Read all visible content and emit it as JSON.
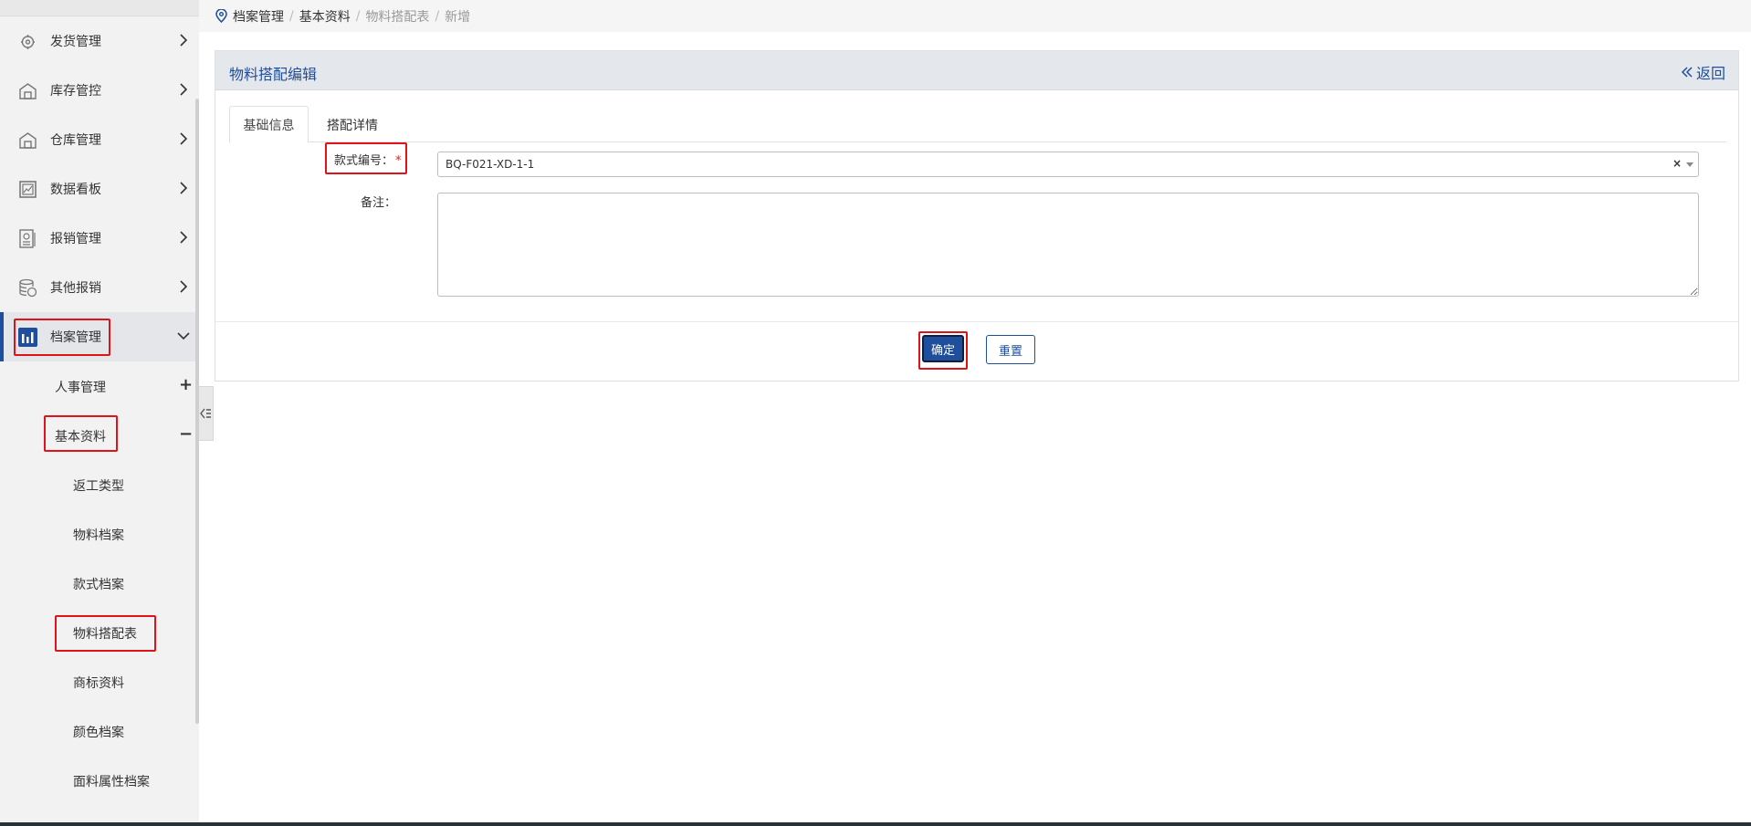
{
  "breadcrumb": {
    "items": [
      "档案管理",
      "基本资料",
      "物料搭配表",
      "新增"
    ]
  },
  "sidebar": {
    "items": [
      {
        "label": "发货管理",
        "icon": "truck-gear-icon"
      },
      {
        "label": "库存管控",
        "icon": "warehouse-icon"
      },
      {
        "label": "仓库管理",
        "icon": "warehouse-icon"
      },
      {
        "label": "数据看板",
        "icon": "chart-board-icon"
      },
      {
        "label": "报销管理",
        "icon": "receipt-icon"
      },
      {
        "label": "其他报销",
        "icon": "coins-icon"
      },
      {
        "label": "档案管理",
        "icon": "bar-chart-icon"
      }
    ],
    "subgroups": [
      {
        "label": "人事管理",
        "toggle": "+"
      },
      {
        "label": "基本资料",
        "toggle": "−"
      }
    ],
    "subitems": [
      "返工类型",
      "物料档案",
      "款式档案",
      "物料搭配表",
      "商标资料",
      "颜色档案",
      "面料属性档案"
    ]
  },
  "panel": {
    "title": "物料搭配编辑",
    "back_label": "返回",
    "tabs": [
      "基础信息",
      "搭配详情"
    ]
  },
  "form": {
    "style_no_label": "款式编号：",
    "required_mark": "*",
    "style_no_value": "BQ-F021-XD-1-1",
    "clear_symbol": "×",
    "remark_label": "备注："
  },
  "actions": {
    "confirm_label": "确定",
    "reset_label": "重置"
  },
  "colors": {
    "primary": "#1f4e9c",
    "highlight": "#e1131a",
    "sidebar_bg": "#f2f2f2"
  }
}
